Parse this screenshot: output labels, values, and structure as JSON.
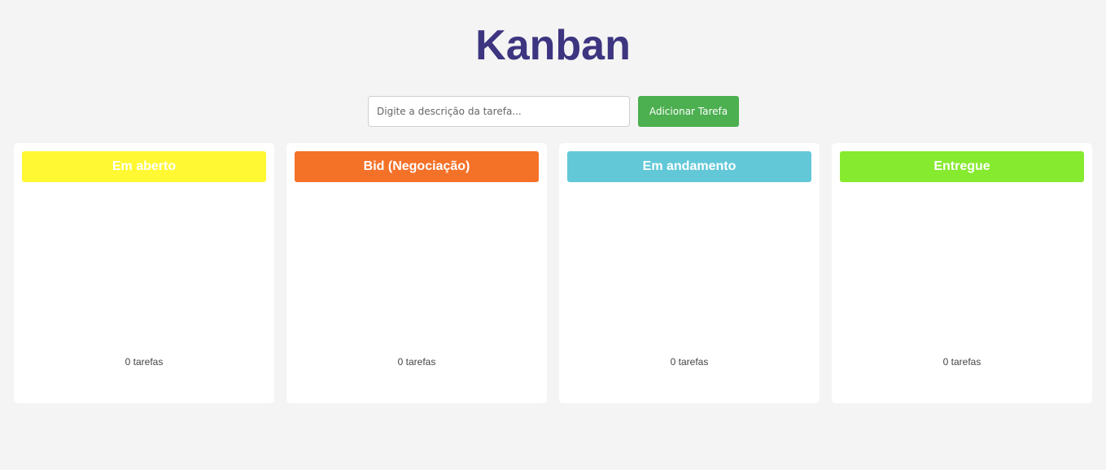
{
  "header": {
    "title": "Kanban"
  },
  "add_task": {
    "placeholder": "Digite a descrição da tarefa...",
    "value": "",
    "button_label": "Adicionar Tarefa"
  },
  "colors": {
    "background": "#f4f4f4",
    "title": "#3d3580",
    "add_button": "#4caf50",
    "column_em_aberto": "#fff833",
    "column_bid": "#f47128",
    "column_em_andamento": "#62c8d8",
    "column_entregue": "#86ea2e"
  },
  "columns": [
    {
      "title": "Em aberto",
      "count_label": "0 tarefas",
      "color": "#fff833"
    },
    {
      "title": "Bid (Negociação)",
      "count_label": "0 tarefas",
      "color": "#f47128"
    },
    {
      "title": "Em andamento",
      "count_label": "0 tarefas",
      "color": "#62c8d8"
    },
    {
      "title": "Entregue",
      "count_label": "0 tarefas",
      "color": "#86ea2e"
    }
  ]
}
